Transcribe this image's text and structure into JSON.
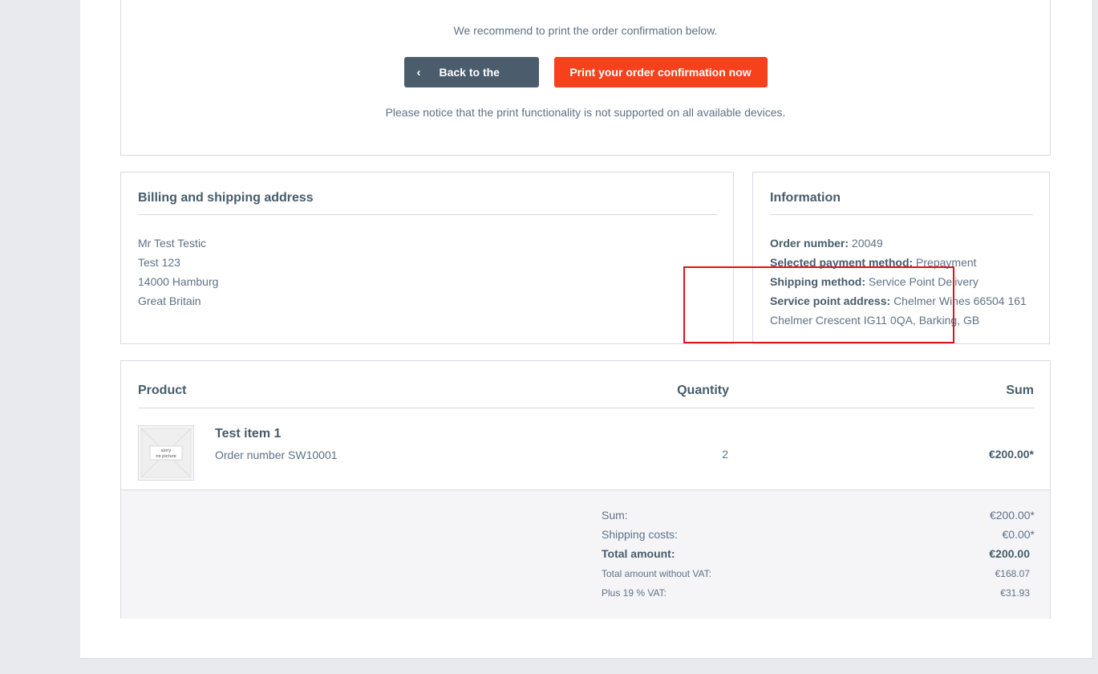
{
  "top": {
    "recommend_text": "We recommend to print the order confirmation below.",
    "back_button_label": "Back to the shop",
    "print_button_label": "Print your order confirmation now",
    "notice_text": "Please notice that the print functionality is not supported on all available devices."
  },
  "billing": {
    "title": "Billing and shipping address",
    "lines": [
      "Mr Test Testic",
      "Test 123",
      "14000 Hamburg",
      "Great Britain"
    ]
  },
  "information": {
    "title": "Information",
    "order_number_label": "Order number:",
    "order_number_value": "20049",
    "payment_label": "Selected payment method:",
    "payment_value": "Prepayment",
    "shipping_label": "Shipping method:",
    "shipping_value": "Service Point Delivery",
    "service_point_label": "Service point address:",
    "service_point_value": "Chelmer Wines 66504 161",
    "service_point_value_line2": "Chelmer Crescent IG11 0QA, Barking, GB"
  },
  "products": {
    "headers": {
      "product": "Product",
      "quantity": "Quantity",
      "sum": "Sum"
    },
    "items": [
      {
        "name": "Test item 1",
        "order_number": "Order number SW10001",
        "quantity": "2",
        "sum": "€200.00*",
        "thumb_text_line1": "sorry",
        "thumb_text_line2": "no picture"
      }
    ],
    "totals": {
      "sum_label": "Sum:",
      "sum_value": "€200.00*",
      "shipping_label": "Shipping costs:",
      "shipping_value": "€0.00*",
      "total_label": "Total amount:",
      "total_value": "€200.00",
      "net_label": "Total amount without VAT:",
      "net_value": "€168.07",
      "vat_label": "Plus 19 % VAT:",
      "vat_value": "€31.93"
    }
  },
  "colors": {
    "back_button": "#4b5d6d",
    "print_button": "#f6411c",
    "highlight_border": "#d9141c"
  },
  "icons": {
    "back_chevron": "chevron-left-icon"
  }
}
